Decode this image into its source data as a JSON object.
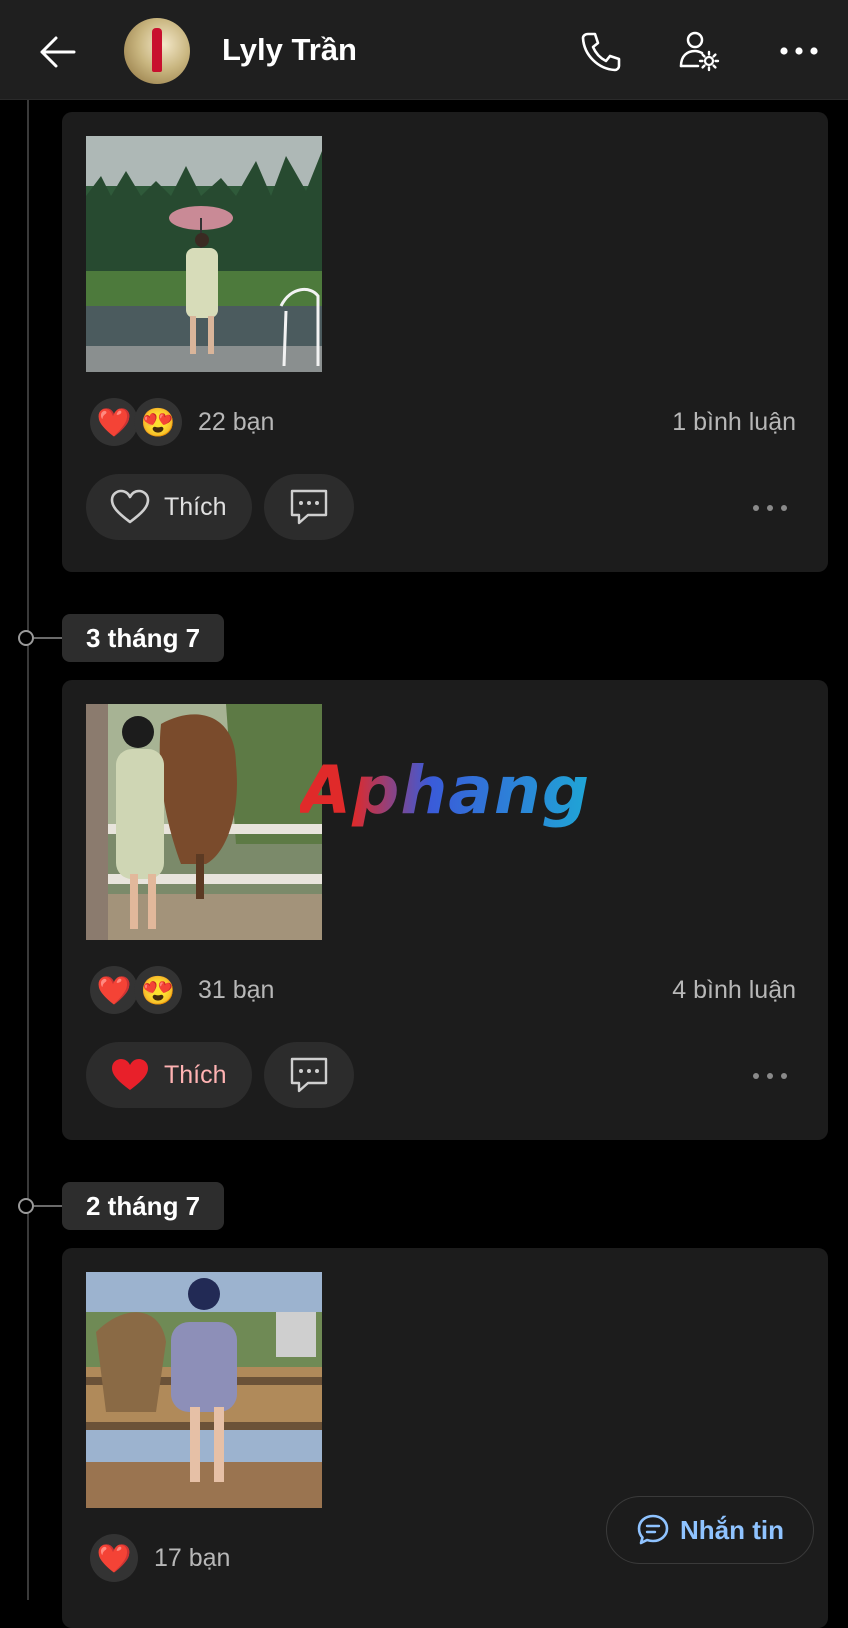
{
  "header": {
    "title": "Lyly Trần",
    "back_icon": "arrow-left-icon",
    "call_icon": "phone-icon",
    "profile_settings_icon": "user-gear-icon",
    "more_icon": "more-horizontal-icon"
  },
  "timeline": {
    "dates": [
      "3 tháng 7",
      "2 tháng 7"
    ]
  },
  "posts": [
    {
      "reactions": [
        "❤️",
        "😍"
      ],
      "reaction_count": "22 bạn",
      "comments": "1 bình luận",
      "like_label": "Thích",
      "liked": false
    },
    {
      "reactions": [
        "❤️",
        "😍"
      ],
      "reaction_count": "31 bạn",
      "comments": "4 bình luận",
      "like_label": "Thích",
      "liked": true
    },
    {
      "reactions": [
        "❤️"
      ],
      "reaction_count": "17 bạn"
    }
  ],
  "watermark": "Aphang",
  "message_button": {
    "label": "Nhắn tin",
    "icon": "chat-bubble-icon"
  },
  "colors": {
    "background": "#000000",
    "card": "#1c1c1c",
    "liked_text": "#ffb3b3",
    "message_accent": "#8fc3ff"
  }
}
